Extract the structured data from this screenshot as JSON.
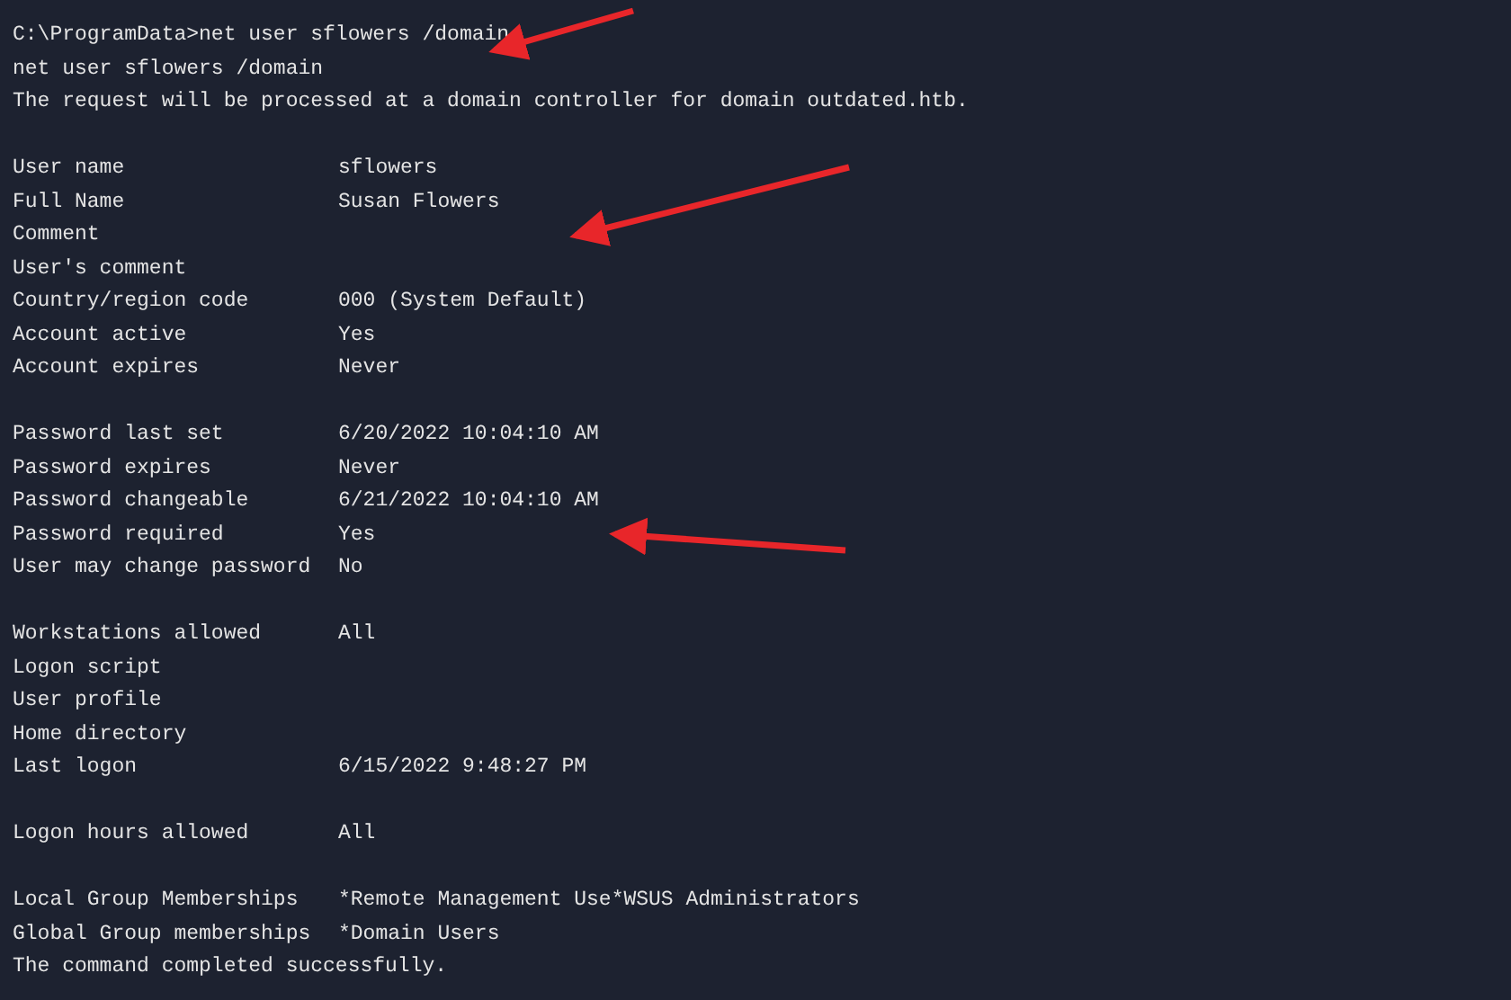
{
  "terminal": {
    "lines": [
      {
        "kind": "text",
        "text": "C:\\ProgramData>net user sflowers /domain"
      },
      {
        "kind": "text",
        "text": "net user sflowers /domain"
      },
      {
        "kind": "text",
        "text": "The request will be processed at a domain controller for domain outdated.htb."
      },
      {
        "kind": "blank"
      },
      {
        "kind": "field",
        "label": "User name",
        "value": "sflowers"
      },
      {
        "kind": "field",
        "label": "Full Name",
        "value": "Susan Flowers"
      },
      {
        "kind": "field",
        "label": "Comment"
      },
      {
        "kind": "field",
        "label": "User's comment"
      },
      {
        "kind": "field",
        "label": "Country/region code",
        "value": "000 (System Default)"
      },
      {
        "kind": "field",
        "label": "Account active",
        "value": "Yes"
      },
      {
        "kind": "field",
        "label": "Account expires",
        "value": "Never"
      },
      {
        "kind": "blank"
      },
      {
        "kind": "field",
        "label": "Password last set",
        "value": "6/20/2022 10:04:10 AM"
      },
      {
        "kind": "field",
        "label": "Password expires",
        "value": "Never"
      },
      {
        "kind": "field",
        "label": "Password changeable",
        "value": "6/21/2022 10:04:10 AM"
      },
      {
        "kind": "field",
        "label": "Password required",
        "value": "Yes"
      },
      {
        "kind": "field",
        "label": "User may change password",
        "value": "No"
      },
      {
        "kind": "blank"
      },
      {
        "kind": "field",
        "label": "Workstations allowed",
        "value": "All"
      },
      {
        "kind": "field",
        "label": "Logon script"
      },
      {
        "kind": "field",
        "label": "User profile"
      },
      {
        "kind": "field",
        "label": "Home directory"
      },
      {
        "kind": "field",
        "label": "Last logon",
        "value": "6/15/2022 9:48:27 PM"
      },
      {
        "kind": "blank"
      },
      {
        "kind": "field",
        "label": "Logon hours allowed",
        "value": "All"
      },
      {
        "kind": "blank"
      },
      {
        "kind": "field",
        "label": "Local Group Memberships",
        "value": "*Remote Management Use*WSUS Administrators"
      },
      {
        "kind": "field",
        "label": "Global Group memberships",
        "value": "*Domain Users"
      },
      {
        "kind": "text",
        "text": "The command completed successfully."
      }
    ]
  }
}
